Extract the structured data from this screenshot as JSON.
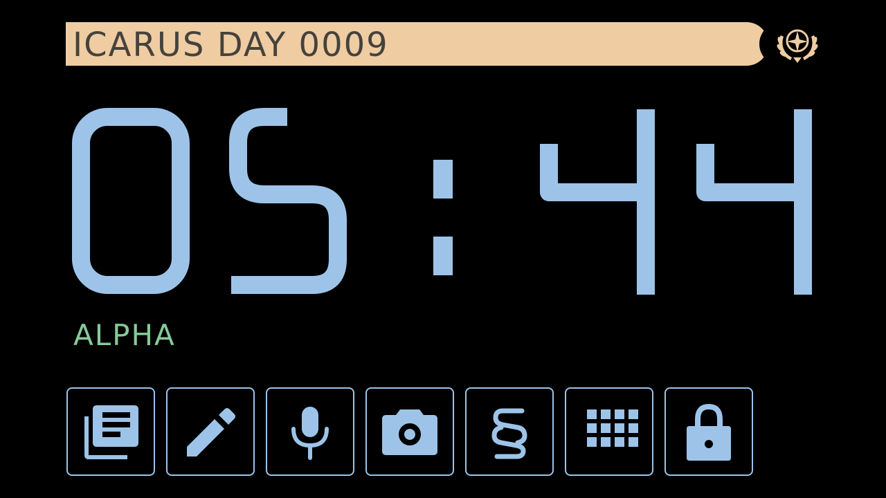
{
  "header": {
    "title": "ICARUS DAY 0009",
    "emblem_icon": "starfleet-emblem-icon",
    "bar_color": "#efcca2",
    "text_color": "#45423c"
  },
  "clock": {
    "hours": "05",
    "minutes": "44",
    "separator": ":",
    "color": "#9dc4e8"
  },
  "shift": {
    "label": "ALPHA",
    "color": "#86c99a"
  },
  "toolbar": {
    "accent": "#9dc4e8",
    "buttons": [
      {
        "name": "log-button",
        "icon": "library-books-icon"
      },
      {
        "name": "edit-button",
        "icon": "pencil-icon"
      },
      {
        "name": "microphone-button",
        "icon": "microphone-icon"
      },
      {
        "name": "camera-button",
        "icon": "camera-icon"
      },
      {
        "name": "section-button",
        "icon": "section-sign-icon"
      },
      {
        "name": "apps-grid-button",
        "icon": "grid-icon"
      },
      {
        "name": "lock-button",
        "icon": "lock-icon"
      }
    ]
  }
}
